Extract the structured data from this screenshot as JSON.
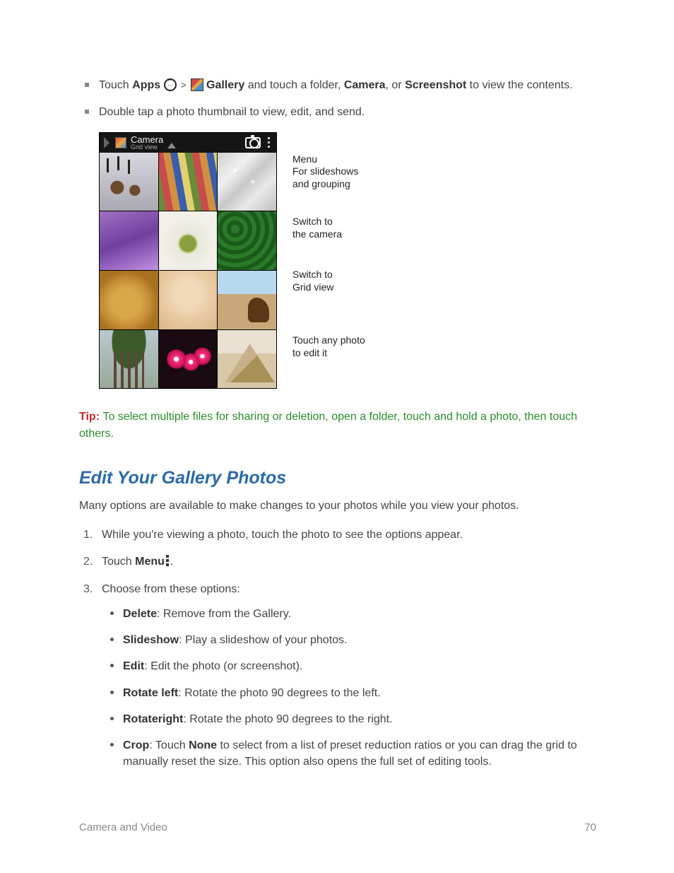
{
  "intro_bullets": {
    "b1": {
      "t1": "Touch ",
      "apps": "Apps",
      "gt": " > ",
      "gallery": "Gallery",
      "t2": " and touch a folder, ",
      "camera": "Camera",
      "t3": ", or ",
      "screenshot": "Screenshot",
      "t4": " to view the contents."
    },
    "b2": "Double tap a photo thumbnail to view, edit, and send."
  },
  "mock": {
    "title": "Camera",
    "subtitle": "Grid view"
  },
  "callouts": {
    "menu_l1": "Menu",
    "menu_l2": "For slideshows",
    "menu_l3": "and grouping",
    "cam_l1": "Switch to",
    "cam_l2": "the camera",
    "grid_l1": "Switch to",
    "grid_l2": "Grid view",
    "touch_l1": "Touch any photo",
    "touch_l2": "to edit it"
  },
  "tip": {
    "label": "Tip: ",
    "text": "To select multiple files for sharing or deletion, open a folder, touch and hold a photo, then touch others."
  },
  "section_heading": "Edit Your Gallery Photos",
  "section_para": "Many options are available to make changes to your photos while you view your photos.",
  "steps": {
    "s1": "While you're viewing a photo, touch the photo to see the options appear.",
    "s2_pre": "Touch ",
    "s2_bold": "Menu",
    "s2_post": ".",
    "s3": "Choose from these options:"
  },
  "options": {
    "delete_b": "Delete",
    "delete_t": ": Remove from the Gallery.",
    "slideshow_b": "Slideshow",
    "slideshow_t": ": Play a slideshow of your photos.",
    "edit_b": "Edit",
    "edit_t": ": Edit the photo (or screenshot).",
    "rotleft_b": "Rotate left",
    "rotleft_t": ": Rotate the photo 90 degrees to the left.",
    "rotright_b": "Rotateright",
    "rotright_t": ": Rotate the photo 90 degrees to the right.",
    "crop_b": "Crop",
    "crop_t1": ": Touch ",
    "crop_none": "None",
    "crop_t2": " to select from a list of preset reduction ratios or you can drag the grid to manually reset the size. This option also opens the full set of editing tools."
  },
  "footer": {
    "section": "Camera and Video",
    "page": "70"
  }
}
